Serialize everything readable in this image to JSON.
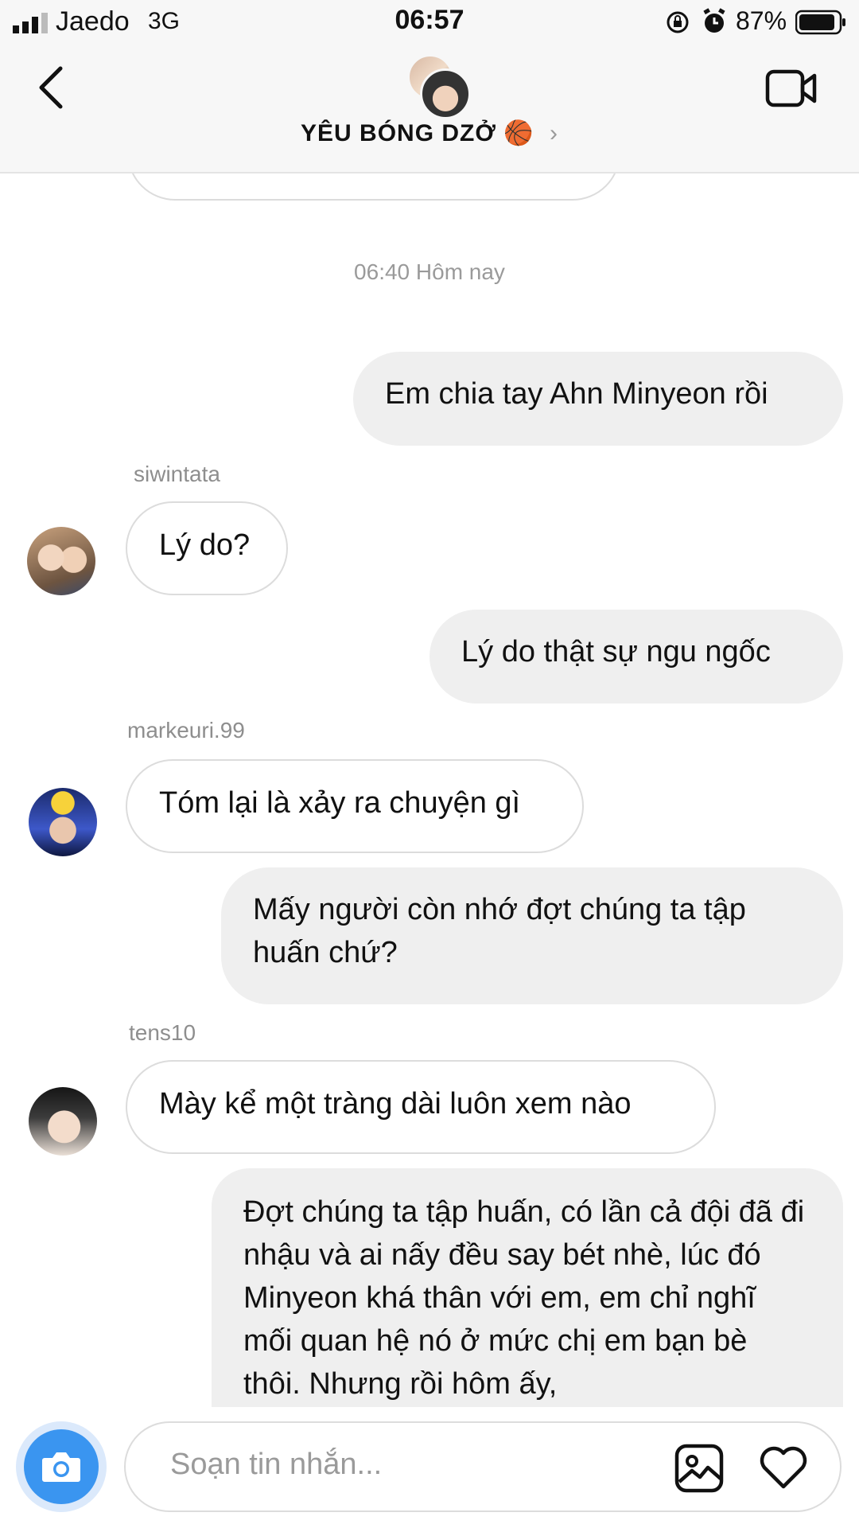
{
  "status_bar": {
    "carrier": "Jaedo",
    "network": "3G",
    "time": "06:57",
    "battery": "87%"
  },
  "header": {
    "title": "YÊU BÓNG DZỞ 🏀",
    "chevron": "›"
  },
  "conversation": {
    "timestamp": "06:40 Hôm nay",
    "messages": [
      {
        "direction": "out",
        "text": "Em chia tay Ahn Minyeon rồi"
      },
      {
        "direction": "in",
        "sender": "siwintata",
        "text": "Lý do?"
      },
      {
        "direction": "out",
        "text": "Lý do thật sự ngu ngốc"
      },
      {
        "direction": "in",
        "sender": "markeuri.99",
        "text": "Tóm lại là xảy ra chuyện gì"
      },
      {
        "direction": "out",
        "text": "Mấy người còn nhớ đợt chúng ta tập huấn chứ?"
      },
      {
        "direction": "in",
        "sender": "tens10",
        "text": "Mày kể một tràng dài luôn xem nào"
      },
      {
        "direction": "out",
        "text": "Đợt chúng ta tập huấn, có lần cả đội đã đi nhậu và ai nấy đều say bét nhè, lúc đó Minyeon khá thân với em, em chỉ nghĩ mối quan hệ nó ở mức chị em bạn bè thôi. Nhưng rồi hôm ấy,"
      }
    ]
  },
  "composer": {
    "placeholder": "Soạn tin nhắn..."
  },
  "colors": {
    "accent": "#3a95f0",
    "bubble_out": "#efefef",
    "bubble_in_border": "#dcdcdc"
  }
}
